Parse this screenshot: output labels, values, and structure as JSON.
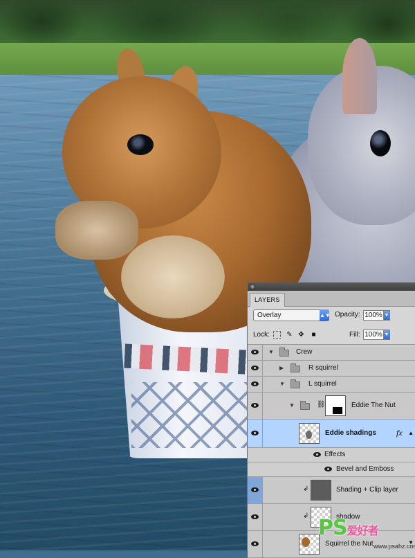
{
  "panel": {
    "tab_label": "LAYERS",
    "blend_mode": "Overlay",
    "opacity_label": "Opacity:",
    "opacity_value": "100%",
    "lock_label": "Lock:",
    "fill_label": "Fill:",
    "fill_value": "100%"
  },
  "layers": [
    {
      "name": "Crew",
      "type": "group",
      "visible": true
    },
    {
      "name": "R squirrel",
      "type": "group",
      "visible": true
    },
    {
      "name": "L squirrel",
      "type": "group",
      "visible": true
    },
    {
      "name": "Eddie The Nut",
      "type": "group-mask",
      "visible": true
    },
    {
      "name": "Eddie shadings",
      "type": "layer",
      "selected": true,
      "fx": "fx"
    },
    {
      "name": "Effects",
      "type": "effects-header"
    },
    {
      "name": "Bevel and Emboss",
      "type": "effect"
    },
    {
      "name": "Shading + Clip layer",
      "type": "clipped"
    },
    {
      "name": "shadow",
      "type": "clipped"
    },
    {
      "name": "Squirrel the Nut",
      "type": "layer"
    }
  ],
  "icons": {
    "blend_dropdown": "chevron-updown-icon",
    "visibility": "eye-icon",
    "group": "folder-icon",
    "link": "chain-link-icon",
    "clip": "clip-arrow-icon",
    "effects": "fx-icon"
  },
  "watermark": {
    "main": "PS",
    "sub": "爱好者",
    "url": "www.psahz.com"
  },
  "colors": {
    "selected_row": "#b3d4ff",
    "accent_blue": "#2d6ad8",
    "panel_bg": "#d6d6d6"
  }
}
